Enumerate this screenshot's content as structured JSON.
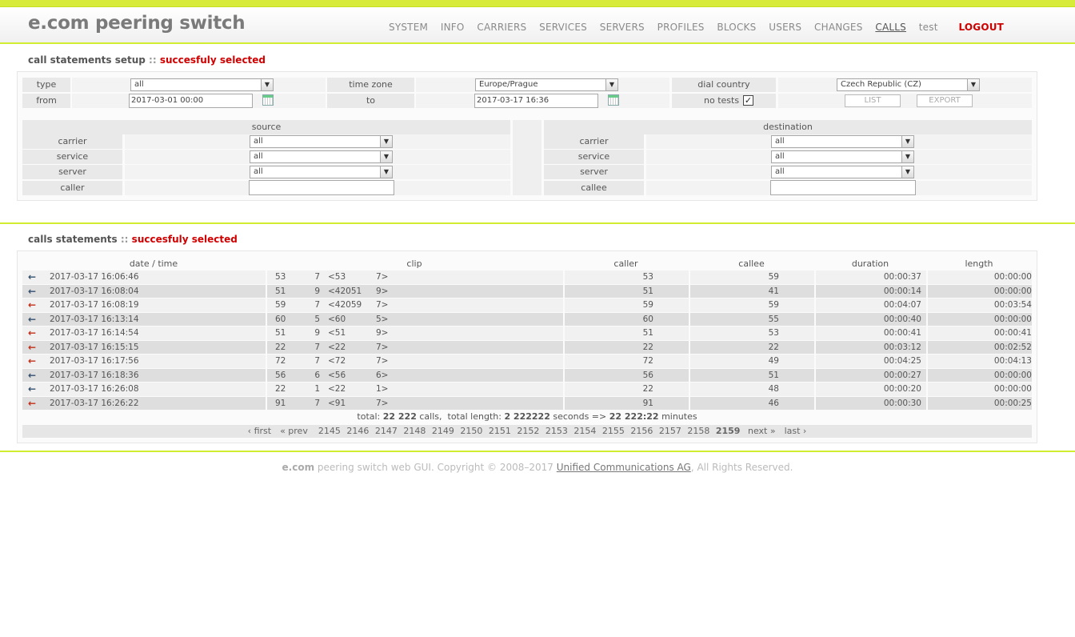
{
  "header": {
    "title": "e.com peering switch",
    "nav": [
      "SYSTEM",
      "INFO",
      "CARRIERS",
      "SERVICES",
      "SERVERS",
      "PROFILES",
      "BLOCKS",
      "USERS",
      "CHANGES",
      "CALLS",
      "test"
    ],
    "logout": "LOGOUT"
  },
  "setup": {
    "title": "call statements setup",
    "sep": "::",
    "status": "succesfuly selected",
    "type_label": "type",
    "type_value": "all",
    "timezone_label": "time zone",
    "timezone_value": "Europe/Prague",
    "country_label": "dial country",
    "country_value": "Czech Republic (CZ)",
    "from_label": "from",
    "from_value": "2017-03-01 00:00",
    "to_label": "to",
    "to_value": "2017-03-17 16:36",
    "notests_label": "no tests",
    "notests_checked": "✓",
    "list_button": "LIST",
    "export_button": "EXPORT",
    "source_label": "source",
    "destination_label": "destination",
    "carrier_label": "carrier",
    "service_label": "service",
    "server_label": "server",
    "caller_label": "caller",
    "callee_label": "callee",
    "src_carrier": "all",
    "src_service": "all",
    "src_server": "all",
    "dst_carrier": "all",
    "dst_service": "all",
    "dst_server": "all"
  },
  "calls": {
    "title": "calls statements",
    "sep": "::",
    "status": "succesfuly selected",
    "columns": [
      "date / time",
      "clip",
      "caller",
      "callee",
      "duration",
      "length"
    ],
    "rows": [
      {
        "dir": "in",
        "datetime": "2017-03-17 16:06:46",
        "c1": "53",
        "c2": "7",
        "c3": "<53",
        "c4": "7>",
        "caller": "53",
        "callee": "59",
        "duration": "00:00:37",
        "length": "00:00:00"
      },
      {
        "dir": "in",
        "datetime": "2017-03-17 16:08:04",
        "c1": "51",
        "c2": "9",
        "c3": "<42051",
        "c4": "9>",
        "caller": "51",
        "callee": "41",
        "duration": "00:00:14",
        "length": "00:00:00"
      },
      {
        "dir": "out",
        "datetime": "2017-03-17 16:08:19",
        "c1": "59",
        "c2": "7",
        "c3": "<42059",
        "c4": "7>",
        "caller": "59",
        "callee": "59",
        "duration": "00:04:07",
        "length": "00:03:54"
      },
      {
        "dir": "in",
        "datetime": "2017-03-17 16:13:14",
        "c1": "60",
        "c2": "5",
        "c3": "<60",
        "c4": "5>",
        "caller": "60",
        "callee": "55",
        "duration": "00:00:40",
        "length": "00:00:00"
      },
      {
        "dir": "out",
        "datetime": "2017-03-17 16:14:54",
        "c1": "51",
        "c2": "9",
        "c3": "<51",
        "c4": "9>",
        "caller": "51",
        "callee": "53",
        "duration": "00:00:41",
        "length": "00:00:41"
      },
      {
        "dir": "out",
        "datetime": "2017-03-17 16:15:15",
        "c1": "22",
        "c2": "7",
        "c3": "<22",
        "c4": "7>",
        "caller": "22",
        "callee": "22",
        "duration": "00:03:12",
        "length": "00:02:52"
      },
      {
        "dir": "out",
        "datetime": "2017-03-17 16:17:56",
        "c1": "72",
        "c2": "7",
        "c3": "<72",
        "c4": "7>",
        "caller": "72",
        "callee": "49",
        "duration": "00:04:25",
        "length": "00:04:13"
      },
      {
        "dir": "in",
        "datetime": "2017-03-17 16:18:36",
        "c1": "56",
        "c2": "6",
        "c3": "<56",
        "c4": "6>",
        "caller": "56",
        "callee": "51",
        "duration": "00:00:27",
        "length": "00:00:00"
      },
      {
        "dir": "in",
        "datetime": "2017-03-17 16:26:08",
        "c1": "22",
        "c2": "1",
        "c3": "<22",
        "c4": "1>",
        "caller": "22",
        "callee": "48",
        "duration": "00:00:20",
        "length": "00:00:00"
      },
      {
        "dir": "out",
        "datetime": "2017-03-17 16:26:22",
        "c1": "91",
        "c2": "7",
        "c3": "<91",
        "c4": "7>",
        "caller": "91",
        "callee": "46",
        "duration": "00:00:30",
        "length": "00:00:25"
      }
    ],
    "totals": {
      "calls_label": "total:",
      "calls_value": "22 222",
      "calls_unit": "calls,",
      "length_label": "total length:",
      "length_value": "2 222222",
      "length_unit": "seconds =>",
      "minutes_value": "22 222:22",
      "minutes_unit": "minutes"
    },
    "pager": {
      "first": "‹ first",
      "prev": "« prev",
      "pages": [
        "2145",
        "2146",
        "2147",
        "2148",
        "2149",
        "2150",
        "2151",
        "2152",
        "2153",
        "2154",
        "2155",
        "2156",
        "2157",
        "2158",
        "2159"
      ],
      "current": "2159",
      "next": "next »",
      "last": "last ›"
    }
  },
  "footer": {
    "brand": "e.com",
    "text": "peering switch web GUI. Copyright © 2008–2017",
    "company": "Unified Communications AG",
    "rights": ", All Rights Reserved."
  },
  "colors": {
    "accent": "#d2ec2f",
    "status": "#d00000",
    "arrow_in": "#34506e",
    "arrow_out": "#c0301b"
  },
  "icons": {
    "in": "arrow-left-blue",
    "out": "arrow-left-red"
  }
}
